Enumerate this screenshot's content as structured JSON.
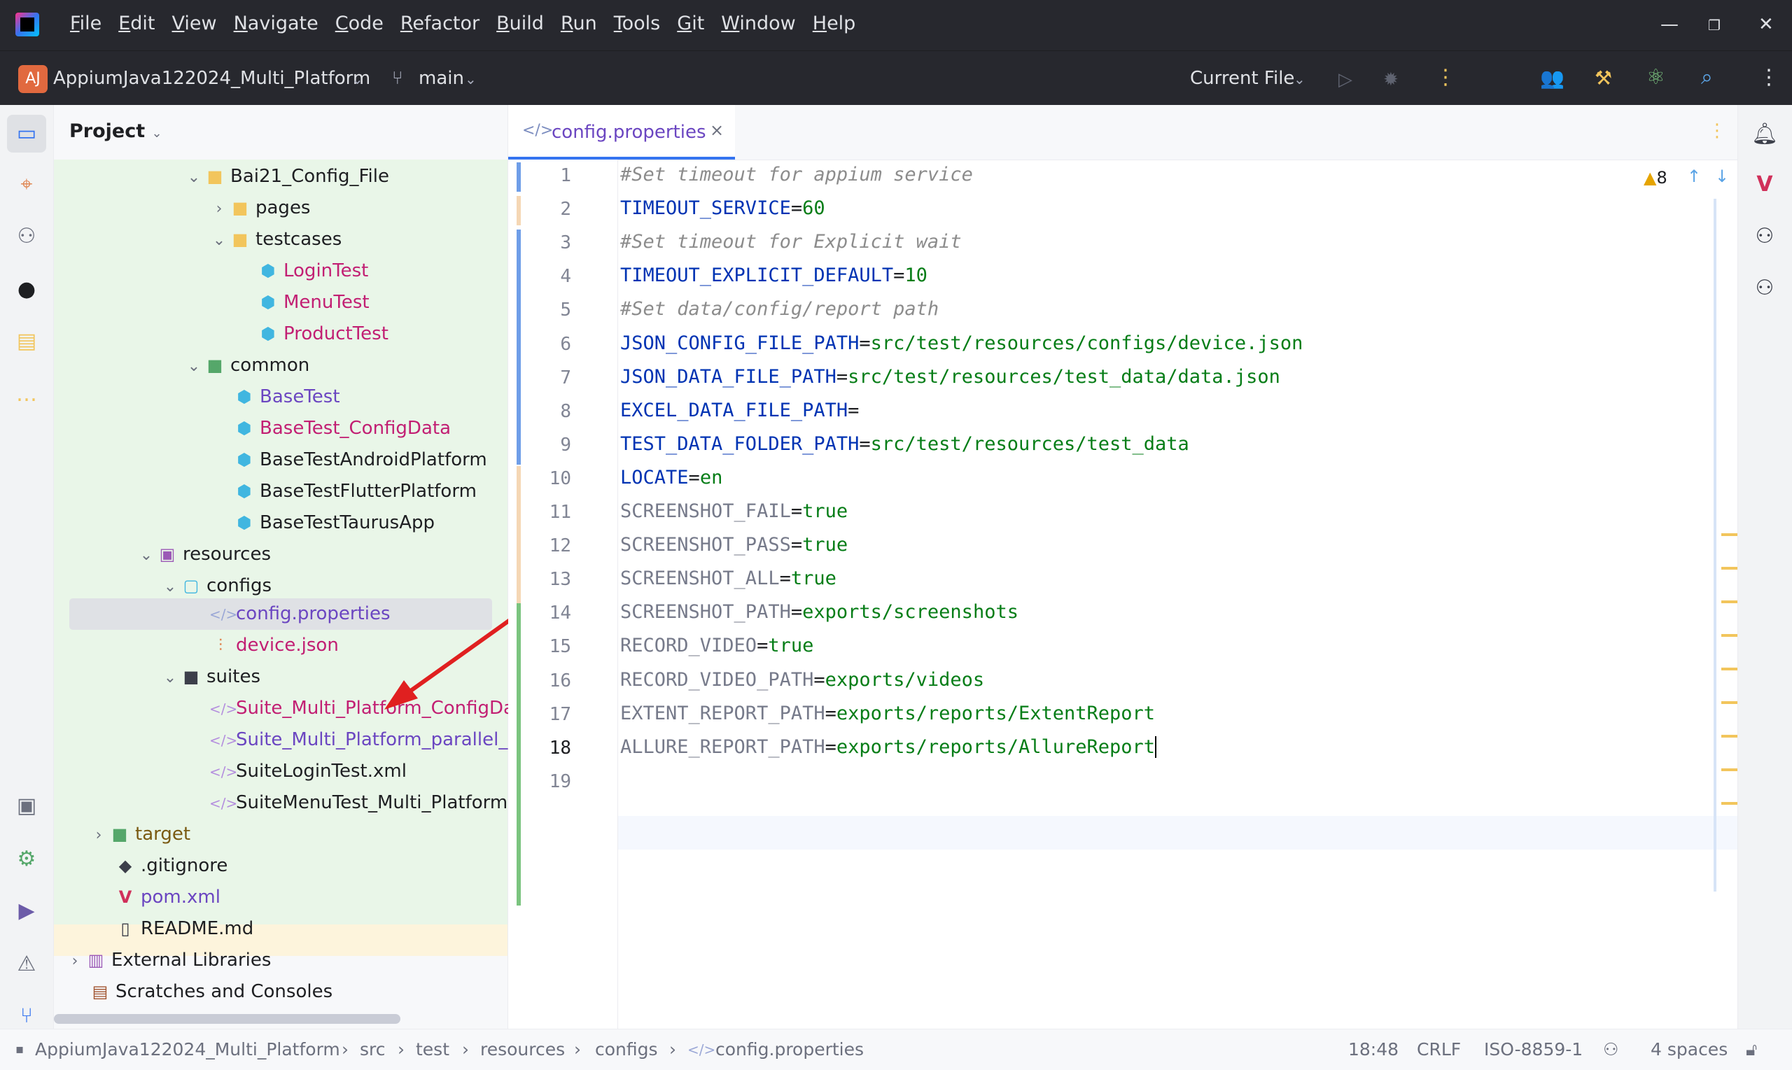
{
  "menu": [
    "File",
    "Edit",
    "View",
    "Navigate",
    "Code",
    "Refactor",
    "Build",
    "Run",
    "Tools",
    "Git",
    "Window",
    "Help"
  ],
  "toolbar": {
    "project_badge": "AJ",
    "project_name": "AppiumJava122024_Multi_Platform",
    "branch": "main",
    "run_config": "Current File"
  },
  "project_panel": {
    "title": "Project",
    "items": [
      {
        "label": "Bai21_Config_File",
        "color": "#1e1f22"
      },
      {
        "label": "pages",
        "color": "#1e1f22"
      },
      {
        "label": "testcases",
        "color": "#1e1f22"
      },
      {
        "label": "LoginTest",
        "color": "#c21f73"
      },
      {
        "label": "MenuTest",
        "color": "#c21f73"
      },
      {
        "label": "ProductTest",
        "color": "#c21f73"
      },
      {
        "label": "common",
        "color": "#1e1f22"
      },
      {
        "label": "BaseTest",
        "color": "#6b46c1"
      },
      {
        "label": "BaseTest_ConfigData",
        "color": "#c21f73"
      },
      {
        "label": "BaseTestAndroidPlatform",
        "color": "#1e1f22"
      },
      {
        "label": "BaseTestFlutterPlatform",
        "color": "#1e1f22"
      },
      {
        "label": "BaseTestTaurusApp",
        "color": "#1e1f22"
      },
      {
        "label": "resources",
        "color": "#1e1f22"
      },
      {
        "label": "configs",
        "color": "#1e1f22"
      },
      {
        "label": "config.properties",
        "color": "#6b46c1"
      },
      {
        "label": "device.json",
        "color": "#c21f73"
      },
      {
        "label": "suites",
        "color": "#1e1f22"
      },
      {
        "label": "Suite_Multi_Platform_ConfigData",
        "color": "#c21f73"
      },
      {
        "label": "Suite_Multi_Platform_parallel_me",
        "color": "#6b46c1"
      },
      {
        "label": "SuiteLoginTest.xml",
        "color": "#1e1f22"
      },
      {
        "label": "SuiteMenuTest_Multi_Platform.x",
        "color": "#1e1f22"
      },
      {
        "label": "target",
        "color": "#7a5a12"
      },
      {
        "label": ".gitignore",
        "color": "#1e1f22"
      },
      {
        "label": "pom.xml",
        "color": "#6b46c1"
      },
      {
        "label": "README.md",
        "color": "#1e1f22"
      },
      {
        "label": "External Libraries",
        "color": "#1e1f22"
      },
      {
        "label": "Scratches and Consoles",
        "color": "#1e1f22"
      }
    ]
  },
  "editor": {
    "tab_label": "config.properties",
    "warning_count": "8",
    "lines": [
      {
        "n": "1",
        "comment": "#Set timeout for appium service"
      },
      {
        "n": "2",
        "key": "TIMEOUT_SERVICE",
        "value": "60",
        "used": true
      },
      {
        "n": "3",
        "comment": "#Set timeout for Explicit wait"
      },
      {
        "n": "4",
        "key": "TIMEOUT_EXPLICIT_DEFAULT",
        "value": "10",
        "used": true
      },
      {
        "n": "5",
        "comment": "#Set data/config/report path"
      },
      {
        "n": "6",
        "key": "JSON_CONFIG_FILE_PATH",
        "value": "src/test/resources/configs/device.json",
        "used": true
      },
      {
        "n": "7",
        "key": "JSON_DATA_FILE_PATH",
        "value": "src/test/resources/test_data/data.json",
        "used": true
      },
      {
        "n": "8",
        "key": "EXCEL_DATA_FILE_PATH",
        "value": "",
        "used": true
      },
      {
        "n": "9",
        "key": "TEST_DATA_FOLDER_PATH",
        "value": "src/test/resources/test_data",
        "used": true
      },
      {
        "n": "10",
        "key": "LOCATE",
        "value": "en",
        "used": true
      },
      {
        "n": "11",
        "key": "SCREENSHOT_FAIL",
        "value": "true",
        "used": false
      },
      {
        "n": "12",
        "key": "SCREENSHOT_PASS",
        "value": "true",
        "used": false
      },
      {
        "n": "13",
        "key": "SCREENSHOT_ALL",
        "value": "true",
        "used": false
      },
      {
        "n": "14",
        "key": "SCREENSHOT_PATH",
        "value": "exports/screenshots",
        "used": false
      },
      {
        "n": "15",
        "key": "RECORD_VIDEO",
        "value": "true",
        "used": false
      },
      {
        "n": "16",
        "key": "RECORD_VIDEO_PATH",
        "value": "exports/videos",
        "used": false
      },
      {
        "n": "17",
        "key": "EXTENT_REPORT_PATH",
        "value": "exports/reports/ExtentReport",
        "used": false
      },
      {
        "n": "18",
        "key": "ALLURE_REPORT_PATH",
        "value": "exports/reports/AllureReport",
        "used": false
      },
      {
        "n": "19"
      }
    ]
  },
  "statusbar": {
    "breadcrumb": [
      "AppiumJava122024_Multi_Platform",
      "src",
      "test",
      "resources",
      "configs",
      "config.properties"
    ],
    "position": "18:48",
    "line_ending": "CRLF",
    "encoding": "ISO-8859-1",
    "indent": "4 spaces"
  },
  "colors": {
    "accent": "#3574f0",
    "annotation_arrow": "#e02020"
  }
}
